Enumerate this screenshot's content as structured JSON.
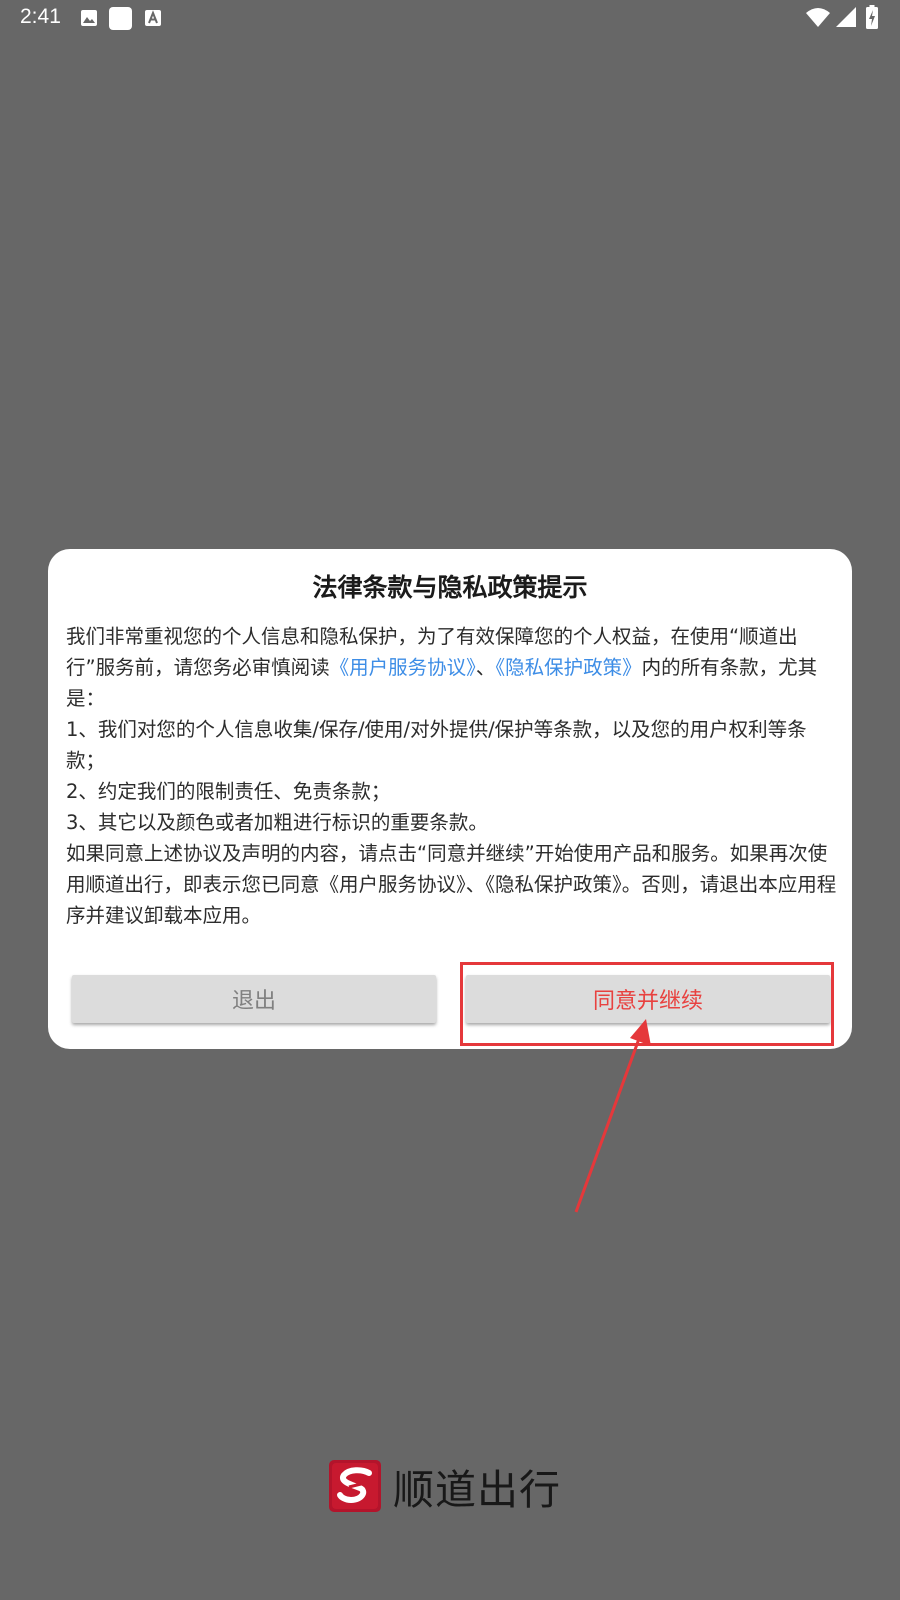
{
  "status_bar": {
    "time": "2:41",
    "left_icons": [
      "image-icon",
      "app-icon",
      "font-icon"
    ],
    "right_icons": [
      "wifi-icon",
      "signal-icon",
      "battery-charging-icon"
    ]
  },
  "dialog": {
    "title": "法律条款与隐私政策提示",
    "intro_before": "我们非常重视您的个人信息和隐私保护，为了有效保障您的个人权益，在使用“顺道出行”服务前，请您务必审慎阅读",
    "link_user_agreement": "《用户服务协议》",
    "separator": "、",
    "link_privacy_policy": "《隐私保护政策》",
    "intro_after": "内的所有条款，尤其是：",
    "item_1": "1、我们对您的个人信息收集/保存/使用/对外提供/保护等条款，以及您的用户权利等条款；",
    "item_2": "2、约定我们的限制责任、免责条款；",
    "item_3": "3、其它以及颜色或者加粗进行标识的重要条款。",
    "closing": "如果同意上述协议及声明的内容，请点击“同意并继续”开始使用产品和服务。如果再次使用顺道出行，即表示您已同意《用户服务协议》、《隐私保护政策》。否则，请退出本应用程序并建议卸载本应用。",
    "exit_label": "退出",
    "agree_label": "同意并继续"
  },
  "brand": {
    "name": "顺道出行",
    "logo_icon": "sd-logo-icon"
  },
  "colors": {
    "overlay": "#676767",
    "link": "#3d8de6",
    "agree_text": "#e8413f",
    "annotation": "#e5383b",
    "logo": "#b3142b"
  }
}
